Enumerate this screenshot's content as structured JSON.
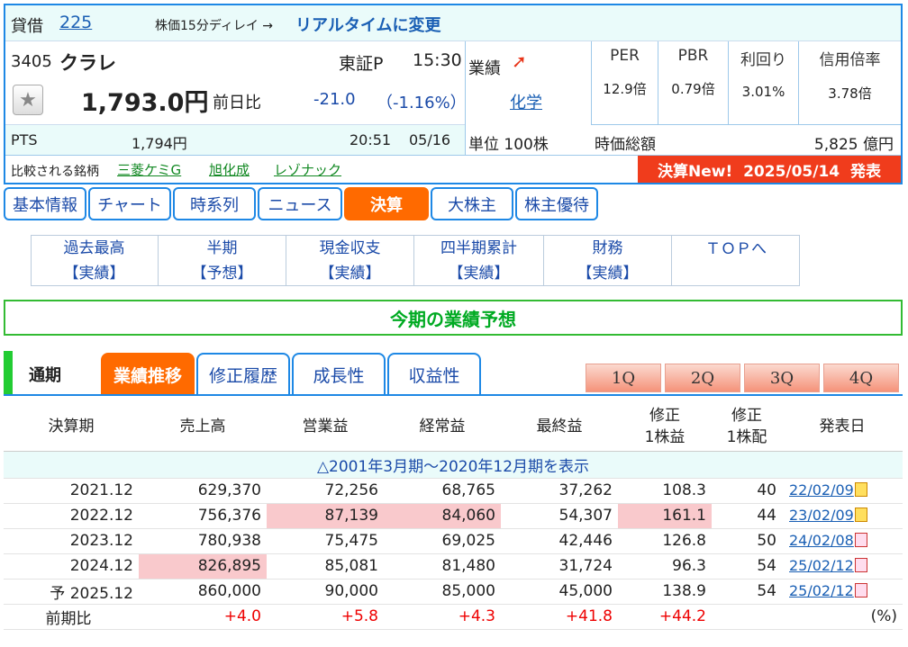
{
  "header": {
    "margin_label": "貸借",
    "index_link": "225",
    "delay_note": "株価15分ディレイ →",
    "realtime_link": "リアルタイムに変更",
    "code": "3405",
    "name": "クラレ",
    "market": "東証P",
    "time": "15:30",
    "price": "1,793.0円",
    "change_label": "前日比",
    "change": "-21.0",
    "change_pct": "（-1.16%）",
    "pts_label": "PTS",
    "pts_price": "1,794円",
    "pts_time": "20:51",
    "pts_date": "05/16",
    "sector_label": "業績",
    "sector_link": "化学",
    "unit": "単位 100株",
    "metrics": [
      {
        "label": "PER",
        "value": "12.9倍"
      },
      {
        "label": "PBR",
        "value": "0.79倍"
      },
      {
        "label": "利回り",
        "value": "3.01%"
      },
      {
        "label": "信用倍率",
        "value": "3.78倍"
      }
    ],
    "mcap_label": "時価総額",
    "mcap_value": "5,825 億円",
    "compare_label": "比較される銘柄",
    "compare": [
      "三菱ケミG",
      "旭化成",
      "レゾナック"
    ],
    "earnings_banner": "決算New!  2025/05/14  発表"
  },
  "tabs": [
    "基本情報",
    "チャート",
    "時系列",
    "ニュース",
    "決算",
    "大株主",
    "株主優待"
  ],
  "subnav": [
    {
      "l1": "過去最高",
      "l2": "【実績】"
    },
    {
      "l1": "半期",
      "l2": "【予想】"
    },
    {
      "l1": "現金収支",
      "l2": "【実績】"
    },
    {
      "l1": "四半期累計",
      "l2": "【実績】"
    },
    {
      "l1": "財務",
      "l2": "【実績】"
    },
    {
      "l1": "ＴＯＰへ",
      "l2": ""
    }
  ],
  "section_title": "今期の業績予想",
  "table_tabs": {
    "period": "通期",
    "items": [
      "業績推移",
      "修正履歴",
      "成長性",
      "収益性"
    ],
    "quarters": [
      "1Q",
      "2Q",
      "3Q",
      "4Q"
    ]
  },
  "table": {
    "headers": [
      "決算期",
      "売上高",
      "営業益",
      "経常益",
      "最終益",
      "修正\n1株益",
      "修正\n1株配",
      "発表日"
    ],
    "expand_link": "△2001年3月期～2020年12月期を表示",
    "rows": [
      {
        "period": "2021.12",
        "sales": "629,370",
        "op": "72,256",
        "ord": "68,765",
        "net": "37,262",
        "eps": "108.3",
        "div": "40",
        "date": "22/02/09",
        "hl": []
      },
      {
        "period": "2022.12",
        "sales": "756,376",
        "op": "87,139",
        "ord": "84,060",
        "net": "54,307",
        "eps": "161.1",
        "div": "44",
        "date": "23/02/09",
        "hl": [
          "op",
          "ord",
          "eps"
        ]
      },
      {
        "period": "2023.12",
        "sales": "780,938",
        "op": "75,475",
        "ord": "69,025",
        "net": "42,446",
        "eps": "126.8",
        "div": "50",
        "date": "24/02/08",
        "hl": []
      },
      {
        "period": "2024.12",
        "sales": "826,895",
        "op": "85,081",
        "ord": "81,480",
        "net": "31,724",
        "eps": "96.3",
        "div": "54",
        "date": "25/02/12",
        "hl": [
          "sales"
        ]
      },
      {
        "period": "予 2025.12",
        "sales": "860,000",
        "op": "90,000",
        "ord": "85,000",
        "net": "45,000",
        "eps": "138.9",
        "div": "54",
        "date": "25/02/12",
        "hl": []
      }
    ],
    "yoy": {
      "label": "前期比",
      "sales": "+4.0",
      "op": "+5.8",
      "ord": "+4.3",
      "net": "+41.8",
      "eps": "+44.2",
      "unit": "(%)"
    }
  },
  "colors": {
    "accent": "#1e88e5",
    "active_tab": "#ff6a00",
    "banner": "#f03c1c",
    "highlight": "#f9c9cc",
    "title_green": "#00aa22"
  }
}
